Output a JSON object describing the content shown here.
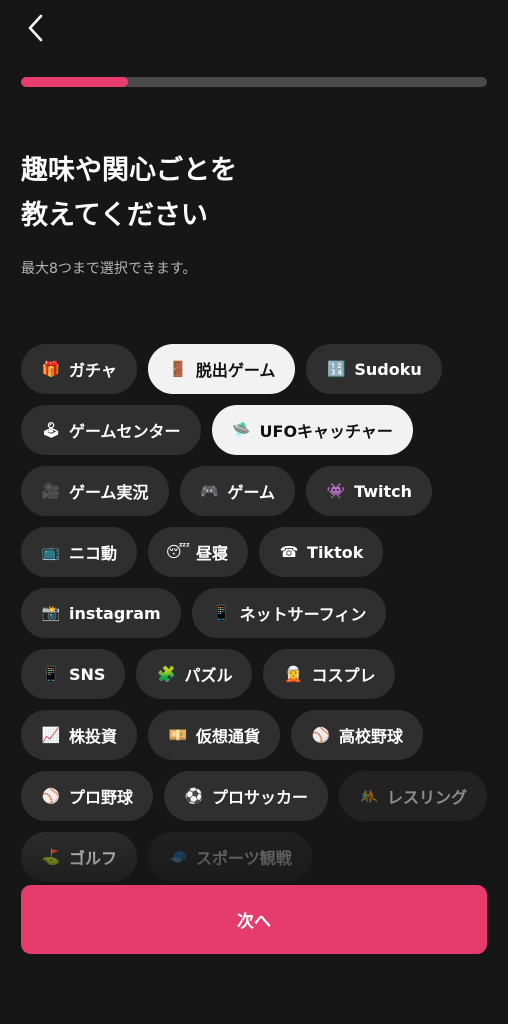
{
  "header": {
    "back_icon": "chevron-left-icon"
  },
  "progress": {
    "value": 0.23,
    "color": "#e83e6f"
  },
  "title": "趣味や関心ごとを\n教えてください",
  "subtitle": "最大8つまで選択できます。",
  "chips": [
    {
      "emoji": "🎁",
      "label": "ガチャ",
      "selected": false
    },
    {
      "emoji": "🚪",
      "label": "脱出ゲーム",
      "selected": true
    },
    {
      "emoji": "🔢",
      "label": "Sudoku",
      "selected": false
    },
    {
      "emoji": "🕹",
      "label": "ゲームセンター",
      "selected": false
    },
    {
      "emoji": "🛸",
      "label": "UFOキャッチャー",
      "selected": true
    },
    {
      "emoji": "🎥",
      "label": "ゲーム実況",
      "selected": false
    },
    {
      "emoji": "🎮",
      "label": "ゲーム",
      "selected": false
    },
    {
      "emoji": "👾",
      "label": "Twitch",
      "selected": false
    },
    {
      "emoji": "📺",
      "label": "ニコ動",
      "selected": false
    },
    {
      "emoji": "😴",
      "label": "昼寝",
      "selected": false
    },
    {
      "emoji": "☎",
      "label": "Tiktok",
      "selected": false
    },
    {
      "emoji": "📸",
      "label": "instagram",
      "selected": false
    },
    {
      "emoji": "📱",
      "label": "ネットサーフィン",
      "selected": false
    },
    {
      "emoji": "📱",
      "label": "SNS",
      "selected": false
    },
    {
      "emoji": "🧩",
      "label": "パズル",
      "selected": false
    },
    {
      "emoji": "🧝",
      "label": "コスプレ",
      "selected": false
    },
    {
      "emoji": "📈",
      "label": "株投資",
      "selected": false
    },
    {
      "emoji": "💴",
      "label": "仮想通貨",
      "selected": false
    },
    {
      "emoji": "⚾",
      "label": "高校野球",
      "selected": false
    },
    {
      "emoji": "⚾",
      "label": "プロ野球",
      "selected": false
    },
    {
      "emoji": "⚽",
      "label": "プロサッカー",
      "selected": false
    },
    {
      "emoji": "🤼",
      "label": "レスリング",
      "selected": false
    },
    {
      "emoji": "⛳",
      "label": "ゴルフ",
      "selected": false
    },
    {
      "emoji": "🧢",
      "label": "スポーツ観戦",
      "selected": false
    }
  ],
  "next_button": {
    "label": "次へ",
    "color": "#e53c6d"
  }
}
